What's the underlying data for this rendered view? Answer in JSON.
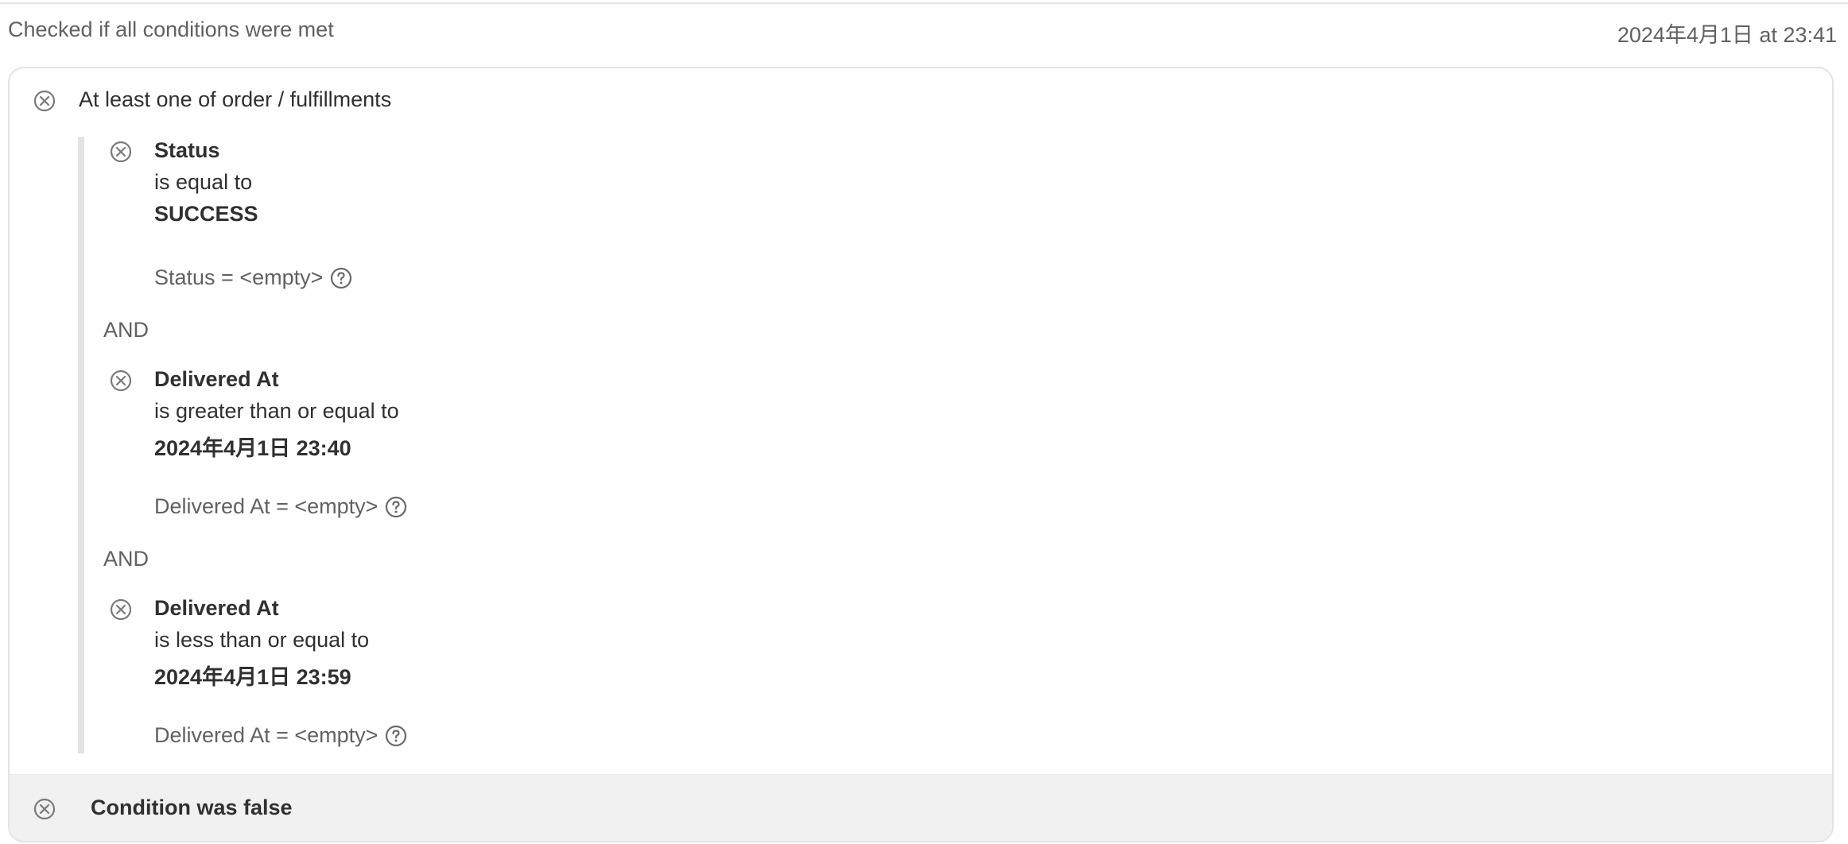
{
  "header": {
    "title": "Checked if all conditions were met",
    "timestamp": "2024年4月1日 at 23:41"
  },
  "group": {
    "label": "At least one of order / fulfillments",
    "icon": "x-circle-icon",
    "conditions": [
      {
        "field": "Status",
        "operator": "is equal to",
        "value": "SUCCESS",
        "actual": "Status = <empty>",
        "icon": "x-circle-icon"
      },
      {
        "field": "Delivered At",
        "operator": "is greater than or equal to",
        "value": "2024年4月1日 23:40",
        "actual": "Delivered At = <empty>",
        "icon": "x-circle-icon"
      },
      {
        "field": "Delivered At",
        "operator": "is less than or equal to",
        "value": "2024年4月1日 23:59",
        "actual": "Delivered At = <empty>",
        "icon": "x-circle-icon"
      }
    ],
    "joiners": [
      "AND",
      "AND"
    ]
  },
  "result": {
    "text": "Condition was false",
    "icon": "x-circle-icon"
  },
  "colors": {
    "text_primary": "#303030",
    "text_secondary": "#616161",
    "border": "#e3e3e3",
    "footer_bg": "#f1f1f1"
  }
}
